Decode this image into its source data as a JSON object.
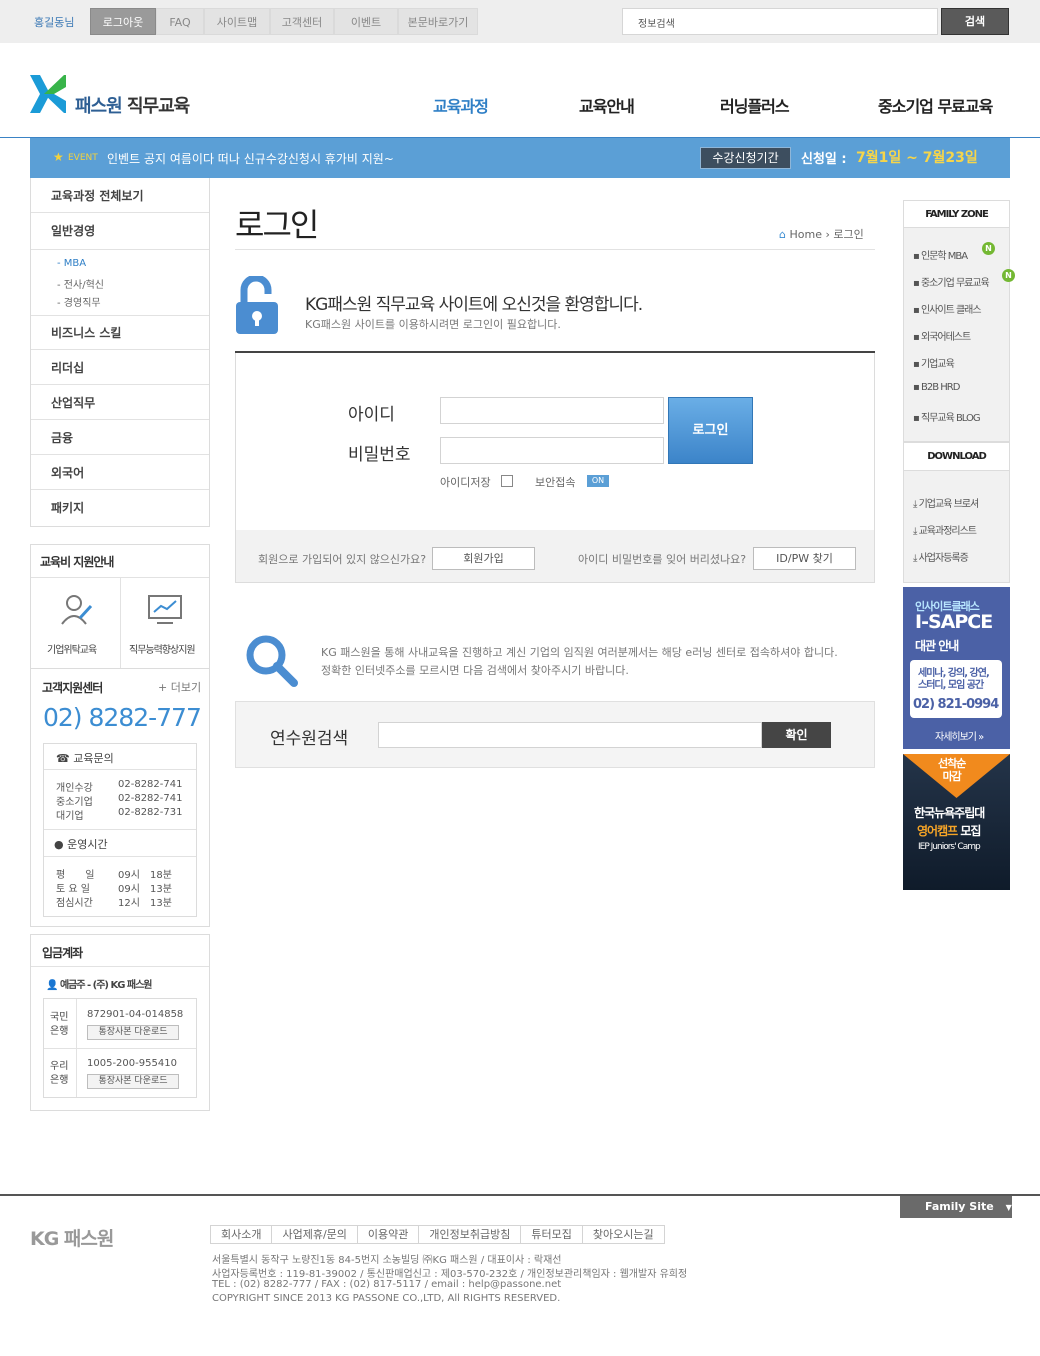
{
  "topbar": {
    "user": "홍길동님",
    "tabs": [
      "로그아웃",
      "FAQ",
      "사이트맵",
      "고객센터",
      "이벤트",
      "본문바로가기"
    ],
    "search_label": "정보검색",
    "search_button": "검색"
  },
  "header": {
    "logo_main": "패스원",
    "logo_sub": "직무교육",
    "nav": [
      "교육과정",
      "교육안내",
      "러닝플러스",
      "중소기업 무료교육"
    ]
  },
  "eventbar": {
    "label": "EVENT",
    "text": "인벤트 공지 여름이다 떠나 신규수강신청시 휴가비 지원~",
    "period": "수강신청기간",
    "apply_label": "신청일 :",
    "apply_date": "7월1일 ~ 7월23일"
  },
  "leftmenu": {
    "items": [
      "교육과정 전체보기",
      "일반경영",
      "비즈니스 스킬",
      "리더십",
      "산업직무",
      "금융",
      "외국어",
      "패키지"
    ],
    "subitems": [
      "MBA",
      "전사/혁신",
      "경영직무"
    ]
  },
  "edu_support": {
    "title": "교육비 지원안내",
    "items": [
      "기업위탁교육",
      "직무능력향상지원"
    ]
  },
  "cs_center": {
    "title": "고객지원센터",
    "more": "더보기",
    "phone": "02) 8282-777",
    "inquiry_title": "교육문의",
    "inquiry_rows": [
      {
        "label": "개인수강",
        "value": "02-8282-741"
      },
      {
        "label": "중소기업",
        "value": "02-8282-741"
      },
      {
        "label": "대기업",
        "value": "02-8282-731"
      }
    ],
    "hours_title": "운영시간",
    "hours_rows": [
      {
        "label": "평　　일",
        "from": "09시",
        "to": "18분"
      },
      {
        "label": "토 요 일",
        "from": "09시",
        "to": "13분"
      },
      {
        "label": "점심시간",
        "from": "12시",
        "to": "13분"
      }
    ]
  },
  "bank": {
    "title": "입금계좌",
    "holder": "예금주 - (주) KG 패스원",
    "accounts": [
      {
        "bank": "국민\n은행",
        "number": "872901-04-014858",
        "button": "통장사본 다운로드"
      },
      {
        "bank": "우리\n은행",
        "number": "1005-200-955410",
        "button": "통장사본 다운로드"
      }
    ]
  },
  "main": {
    "title": "로그인",
    "crumb_home": "Home",
    "crumb_current": "로그인",
    "welcome": "KG패스원 직무교육 사이트에 오신것을 환영합니다.",
    "welcome_sub": "KG패스원 사이트를 이용하시려면 로그인이 필요합니다.",
    "id_label": "아이디",
    "pw_label": "비밀번호",
    "login_button": "로그인",
    "save_id": "아이디저장",
    "secure": "보안접속",
    "secure_badge": "ON",
    "join_q": "회원으로 가입되어 있지 않으신가요?",
    "join_button": "회원가입",
    "find_q": "아이디 비밀번호를 잊어 버리셨나요?",
    "find_button": "ID/PW 찾기",
    "info_line1": "KG 패스원을 통해 사내교육을 진행하고 계신 기업의 임직원 여러분께서는 해당 e러닝 센터로 접속하셔야 합니다.",
    "info_line2": "정확한 인터넷주소를 모르시면 다음 검색에서 찾아주시기 바랍니다.",
    "center_search_label": "연수원검색",
    "center_search_button": "확인"
  },
  "right": {
    "family_title": "FAMILY ZONE",
    "family_items": [
      "인문학 MBA",
      "중소기업 무료교육",
      "인사이트 클래스",
      "외국어테스트",
      "기업교육",
      "B2B HRD",
      "직무교육 BLOG"
    ],
    "new_badge": "N",
    "download_title": "DOWNLOAD",
    "download_items": [
      "기업교육 브로셔",
      "교육과정리스트",
      "사업자등록증"
    ],
    "banner1": {
      "t1": "인사이트클래스",
      "t2": "I-SAPCE",
      "t3": "대관 안내",
      "c1": "세미나, 강의, 강연,",
      "c2": "스터디, 모임 공간",
      "phone": "02) 821-0994",
      "more": "자세히보기 »"
    },
    "banner2": {
      "t1": "선착순\n마감",
      "t2": "한국뉴욕주립대",
      "t3a": "영어캠프",
      "t3b": " 모집",
      "t4": "IEP Juniors' Camp"
    }
  },
  "footer": {
    "family_site": "Family Site",
    "logo": "KG 패스원",
    "links": [
      "회사소개",
      "사업제휴/문의",
      "이용약관",
      "개인정보취급방침",
      "튜터모집",
      "찾아오시는길"
    ],
    "info": [
      "서울특별시 동작구 노량진1동 84-5번지 소농빌딩 ㈜KG 패스원 / 대표이사 : 락재선",
      "사업자등록번호 : 119-81-39002 / 통신판매업신고 : 제03-570-232호 / 개인정보관리책임자 : 웹개발자 유희정",
      "TEL : (02) 8282-777 / FAX : (02) 817-5117 / email : help@passone.net",
      "COPYRIGHT SINCE 2013 KG PASSONE CO.,LTD, All RIGHTS RESERVED."
    ]
  }
}
